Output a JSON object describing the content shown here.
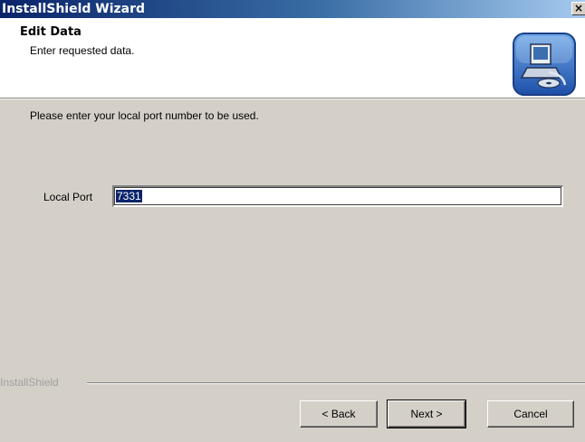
{
  "window": {
    "title": "InstallShield Wizard",
    "close_glyph": "×",
    "close_icon": "close-icon"
  },
  "header": {
    "title": "Edit Data",
    "subtitle": "Enter requested data.",
    "icon": "computer-setup-icon"
  },
  "body": {
    "instruction": "Please enter your local port number to be used.",
    "port_label": "Local Port",
    "port_value": "7331"
  },
  "footer": {
    "brand": "InstallShield",
    "buttons": {
      "back_label": "< Back",
      "next_label": "Next >",
      "cancel_label": "Cancel"
    }
  }
}
